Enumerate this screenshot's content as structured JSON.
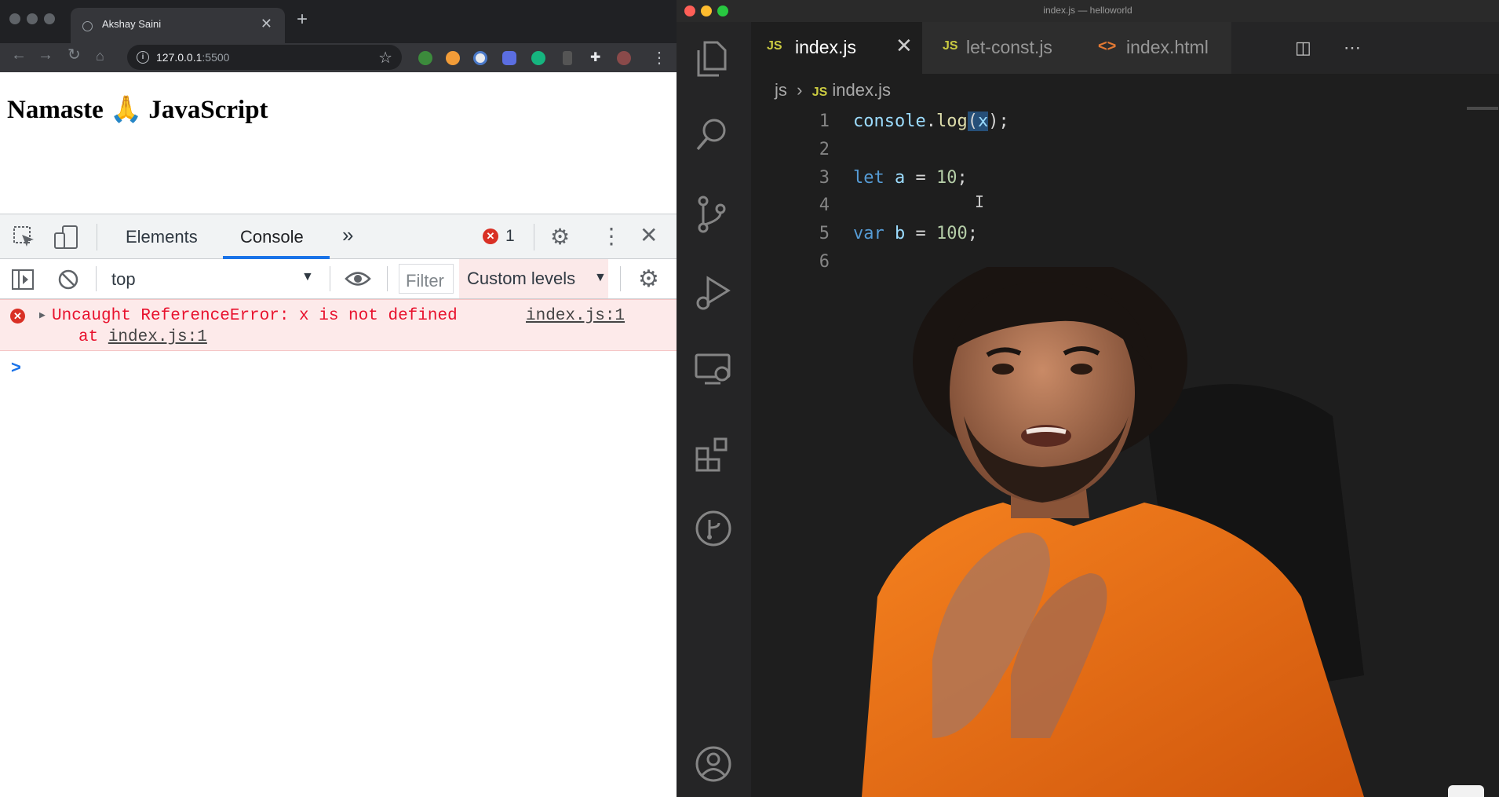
{
  "browser": {
    "tab_title": "Akshay Saini",
    "url_host": "127.0.0.1",
    "url_port": ":5500",
    "page_heading": "Namaste 🙏 JavaScript"
  },
  "devtools": {
    "tabs": [
      "Elements",
      "Console"
    ],
    "active_tab": "Console",
    "more_tabs": "»",
    "error_count": "1",
    "context": "top",
    "filter_placeholder": "Filter",
    "levels": "Custom levels",
    "console": {
      "error_message": "Uncaught ReferenceError: x is not defined",
      "error_at_prefix": "at",
      "error_at_link": "index.js:1",
      "error_source": "index.js:1",
      "prompt": ">"
    }
  },
  "vscode": {
    "window_title": "index.js — helloworld",
    "tabs": [
      {
        "icon": "JS",
        "label": "index.js",
        "active": true
      },
      {
        "icon": "JS",
        "label": "let-const.js",
        "active": false
      },
      {
        "icon": "<>",
        "label": "index.html",
        "active": false
      }
    ],
    "breadcrumb": {
      "folder": "js",
      "file_icon": "JS",
      "file": "index.js"
    },
    "line_numbers": [
      "1",
      "2",
      "3",
      "4",
      "5",
      "6"
    ],
    "code": {
      "line1": {
        "obj": "console",
        "dot": ".",
        "fn": "log",
        "open": "(",
        "arg": "x",
        "close": ");"
      },
      "line3": {
        "kw": "let",
        "id": "a",
        "op": " = ",
        "num": "10",
        "end": ";"
      },
      "line5": {
        "kw": "var",
        "id": "b",
        "op": " = ",
        "num": "100",
        "end": ";"
      }
    }
  },
  "colors": {
    "devtools_accent": "#1a73e8",
    "error_red": "#e8112d",
    "error_bg": "#fdeaea",
    "vscode_bg": "#1e1e1e",
    "js_icon": "#cbcb41",
    "shirt_orange": "#f47a1f"
  }
}
